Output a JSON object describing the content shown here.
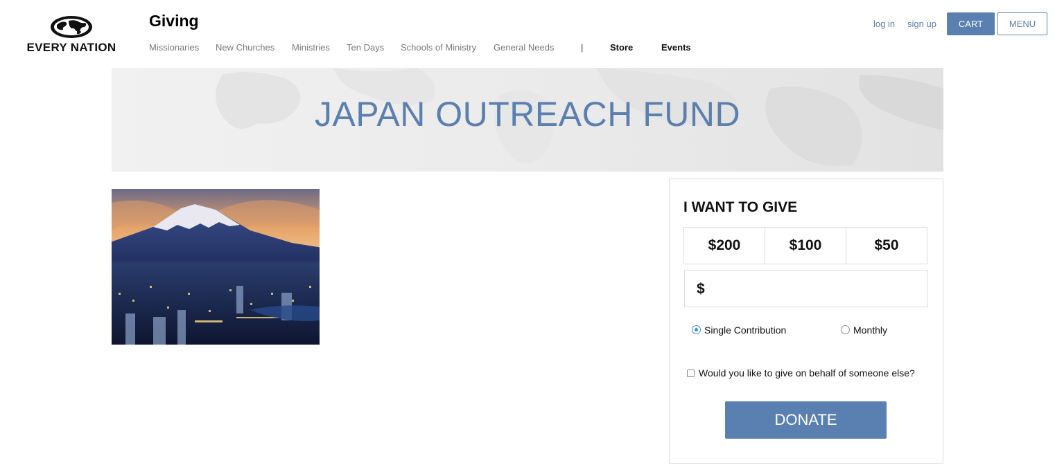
{
  "brand": {
    "logo_text": "EVERY NATION",
    "site_title": "Giving",
    "accent_color": "#5a80b1",
    "title_color": "#5b80b0"
  },
  "nav": {
    "items": [
      {
        "label": "Missionaries"
      },
      {
        "label": "New Churches"
      },
      {
        "label": "Ministries"
      },
      {
        "label": "Ten Days"
      },
      {
        "label": "Schools of Ministry"
      },
      {
        "label": "General Needs"
      },
      {
        "label": "Store"
      },
      {
        "label": "Events"
      }
    ],
    "separator": "|"
  },
  "header_actions": {
    "login": "log in",
    "signup": "sign up",
    "cart": "CART",
    "menu": "MENU"
  },
  "banner": {
    "title": "JAPAN OUTREACH FUND"
  },
  "photo": {
    "icon": "mount-fuji-city-photo"
  },
  "give": {
    "heading": "I WANT TO GIVE",
    "amounts": [
      "$200",
      "$100",
      "$50"
    ],
    "currency": "$",
    "custom_value": "",
    "frequency": [
      {
        "label": "Single Contribution",
        "selected": true
      },
      {
        "label": "Monthly",
        "selected": false
      }
    ],
    "behalf_label": "Would you like to give on behalf of someone else?",
    "behalf_checked": false,
    "donate": "DONATE"
  }
}
